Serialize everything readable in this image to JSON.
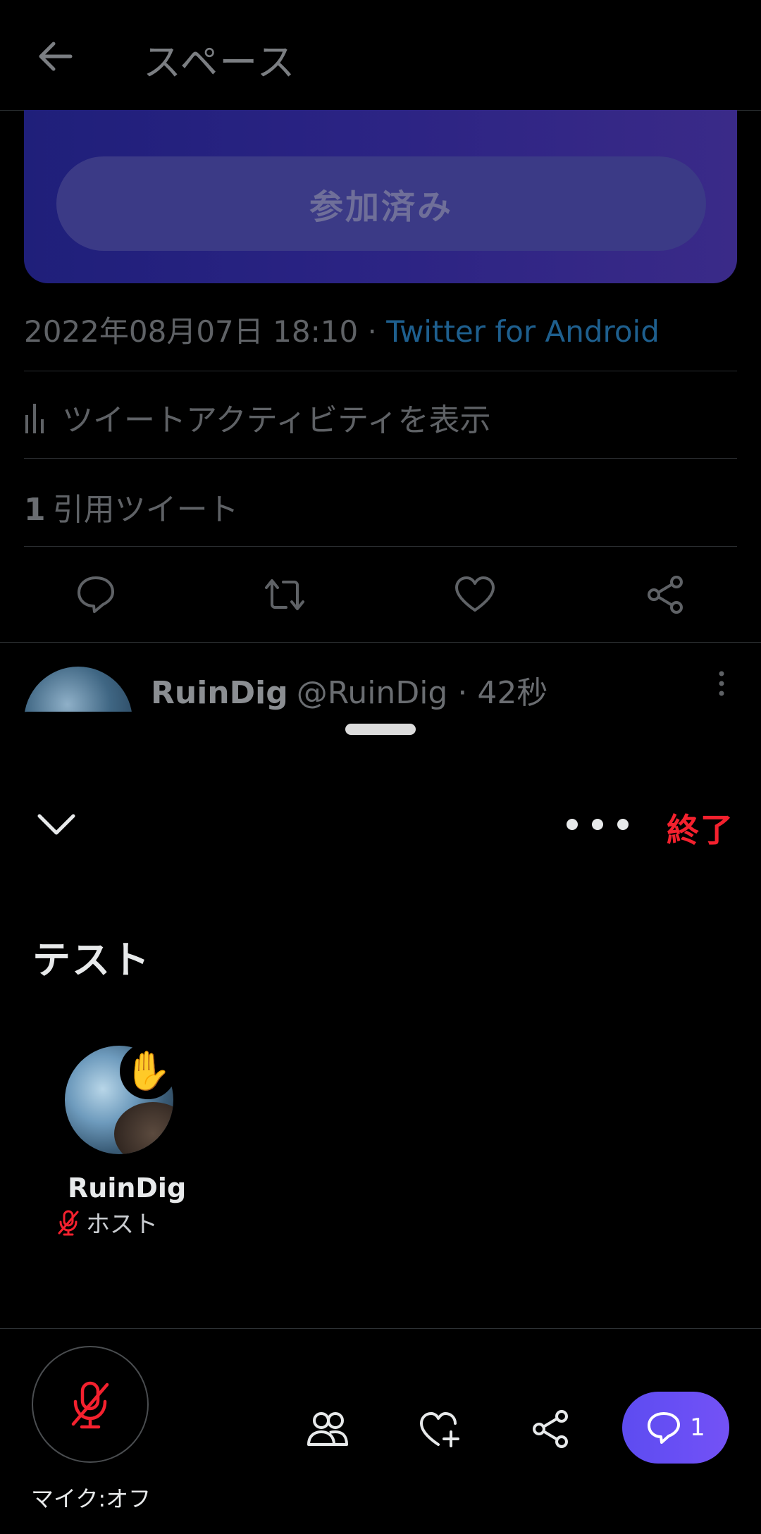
{
  "header": {
    "title": "スペース"
  },
  "space_card": {
    "joined_label": "参加済み"
  },
  "tweet_meta": {
    "datetime": "2022年08月07日 18:10",
    "separator": "·",
    "source": "Twitter for Android"
  },
  "activity": {
    "label": "ツイートアクティビティを表示"
  },
  "quotes": {
    "count": "1",
    "label": "引用ツイート"
  },
  "reply": {
    "display_name": "RuinDig",
    "handle": "@RuinDig",
    "separator": "·",
    "time": "42秒"
  },
  "sheet": {
    "end_label": "終了",
    "space_title": "テスト",
    "host": {
      "name": "RuinDig",
      "role": "ホスト",
      "badge_emoji": "✋"
    },
    "mic_label": "マイク:オフ",
    "chat_count": "1"
  },
  "colors": {
    "end_red": "#f4212e",
    "chat_purple": "#6a4ff5",
    "mic_off_red": "#f4212e",
    "link_blue": "#1e5f8e"
  },
  "icons": [
    "back-arrow-icon",
    "bar-chart-icon",
    "reply-icon",
    "retweet-icon",
    "like-icon",
    "share-icon",
    "more-vertical-icon",
    "chevron-down-icon",
    "more-horizontal-icon",
    "raised-hand-icon",
    "mic-off-icon",
    "people-icon",
    "heart-plus-icon",
    "share-icon",
    "chat-bubble-icon"
  ]
}
